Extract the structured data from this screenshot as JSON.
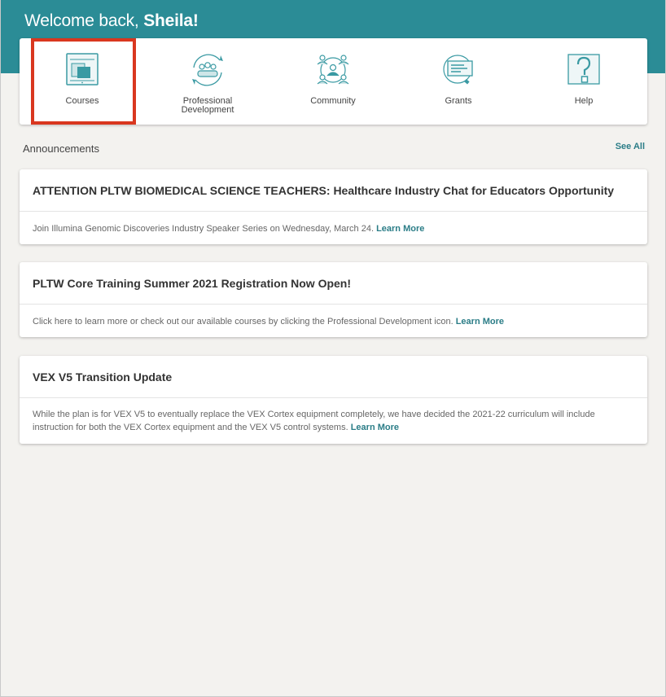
{
  "header": {
    "welcome_prefix": "Welcome back, ",
    "user_name": "Sheila!"
  },
  "nav": {
    "items": [
      {
        "label": "Courses",
        "icon": "courses-icon"
      },
      {
        "label": "Professional",
        "label2": "Development",
        "icon": "professional-development-icon"
      },
      {
        "label": "Community",
        "icon": "community-icon"
      },
      {
        "label": "Grants",
        "icon": "grants-icon"
      },
      {
        "label": "Help",
        "icon": "help-icon"
      }
    ]
  },
  "announcements": {
    "title": "Announcements",
    "see_all": "See All",
    "items": [
      {
        "title": "ATTENTION PLTW BIOMEDICAL SCIENCE TEACHERS: Healthcare Industry Chat for Educators Opportunity",
        "body": "Join Illumina Genomic Discoveries Industry Speaker Series on Wednesday, March 24. ",
        "link": "Learn More"
      },
      {
        "title": "PLTW Core Training Summer 2021 Registration Now Open!",
        "body": "Click here to learn more or check out our available courses by clicking the Professional Development icon. ",
        "link": "Learn More"
      },
      {
        "title": "VEX V5 Transition Update",
        "body": "While the plan is for VEX V5 to eventually replace the VEX Cortex equipment completely, we have decided the 2021-22 curriculum will include instruction for both the VEX Cortex equipment and the VEX V5 control systems. ",
        "link": "Learn More"
      }
    ]
  },
  "colors": {
    "header_teal": "#2b8c96",
    "icon_teal": "#3a9aa3",
    "link_teal": "#2b7d87",
    "highlight_red": "#d9371f"
  }
}
